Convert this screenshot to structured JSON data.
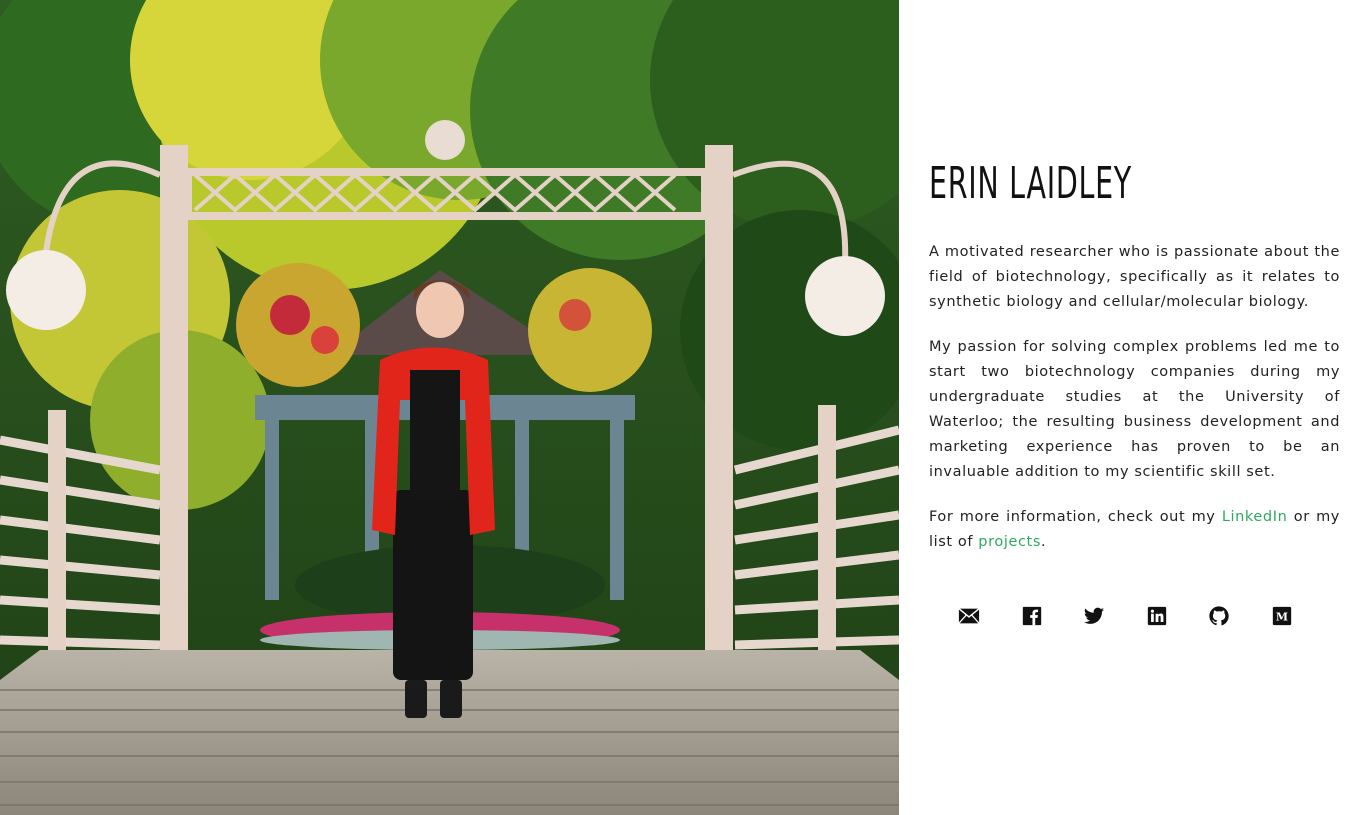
{
  "profile": {
    "name": "ERIN LAIDLEY",
    "photo_alt": "Portrait photo"
  },
  "bio": {
    "p1": "A motivated researcher who is passionate about the field of biotechnology, specifically as it relates to synthetic biology and cellular/molecular biology.",
    "p2": "My passion for solving complex problems led me to start two biotechnology companies during my undergraduate studies at the University of Waterloo; the resulting business development and marketing experience has proven to be an invaluable addition to my scientific skill set.",
    "p3_prefix": "For more information, check out my ",
    "p3_link1": "LinkedIn",
    "p3_middle": " or my list of ",
    "p3_link2": "projects",
    "p3_suffix": "."
  },
  "social": [
    {
      "icon": "email-icon"
    },
    {
      "icon": "facebook-icon"
    },
    {
      "icon": "twitter-icon"
    },
    {
      "icon": "linkedin-icon"
    },
    {
      "icon": "github-icon"
    },
    {
      "icon": "medium-icon"
    }
  ],
  "colors": {
    "link": "#2eaa5d",
    "text": "#222222",
    "background": "#ffffff"
  }
}
